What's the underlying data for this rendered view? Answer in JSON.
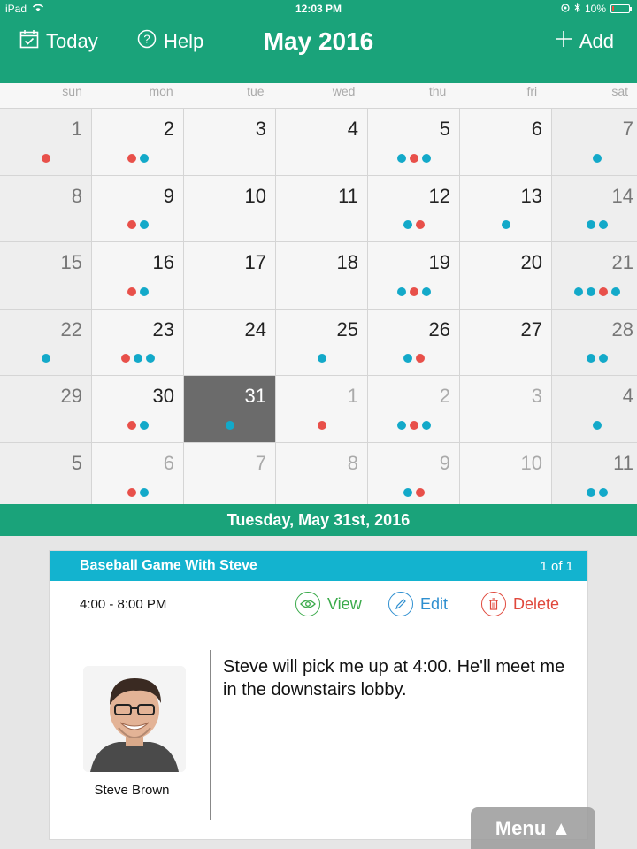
{
  "status_bar": {
    "device": "iPad",
    "time": "12:03 PM",
    "battery": "10%",
    "battery_level": 0.1
  },
  "nav": {
    "today": "Today",
    "help": "Help",
    "title": "May 2016",
    "add": "Add"
  },
  "weekdays": [
    "sun",
    "mon",
    "tue",
    "wed",
    "thu",
    "fri",
    "sat"
  ],
  "colors": {
    "primary": "#1aa37a",
    "accent_blue": "#13b3cf",
    "dot_red": "#e8504a",
    "dot_blue": "#13a9c9",
    "view": "#3aaa4a",
    "edit": "#2e8fd0",
    "delete": "#e0483c"
  },
  "calendar": {
    "days": [
      {
        "n": "1",
        "dots": [
          "r"
        ],
        "other": false
      },
      {
        "n": "2",
        "dots": [
          "r",
          "b"
        ],
        "other": false
      },
      {
        "n": "3",
        "dots": [],
        "other": false
      },
      {
        "n": "4",
        "dots": [],
        "other": false
      },
      {
        "n": "5",
        "dots": [
          "b",
          "r",
          "b"
        ],
        "other": false
      },
      {
        "n": "6",
        "dots": [],
        "other": false
      },
      {
        "n": "7",
        "dots": [
          "b"
        ],
        "other": false
      },
      {
        "n": "8",
        "dots": [],
        "other": false
      },
      {
        "n": "9",
        "dots": [
          "r",
          "b"
        ],
        "other": false
      },
      {
        "n": "10",
        "dots": [],
        "other": false
      },
      {
        "n": "11",
        "dots": [],
        "other": false
      },
      {
        "n": "12",
        "dots": [
          "b",
          "r"
        ],
        "other": false
      },
      {
        "n": "13",
        "dots": [
          "b"
        ],
        "other": false
      },
      {
        "n": "14",
        "dots": [
          "b",
          "b"
        ],
        "other": false
      },
      {
        "n": "15",
        "dots": [],
        "other": false
      },
      {
        "n": "16",
        "dots": [
          "r",
          "b"
        ],
        "other": false
      },
      {
        "n": "17",
        "dots": [],
        "other": false
      },
      {
        "n": "18",
        "dots": [],
        "other": false
      },
      {
        "n": "19",
        "dots": [
          "b",
          "r",
          "b"
        ],
        "other": false
      },
      {
        "n": "20",
        "dots": [],
        "other": false
      },
      {
        "n": "21",
        "dots": [
          "b",
          "b",
          "r",
          "b"
        ],
        "other": false
      },
      {
        "n": "22",
        "dots": [
          "b"
        ],
        "other": false
      },
      {
        "n": "23",
        "dots": [
          "r",
          "b",
          "b"
        ],
        "other": false
      },
      {
        "n": "24",
        "dots": [],
        "other": false
      },
      {
        "n": "25",
        "dots": [
          "b"
        ],
        "other": false
      },
      {
        "n": "26",
        "dots": [
          "b",
          "r"
        ],
        "other": false
      },
      {
        "n": "27",
        "dots": [],
        "other": false
      },
      {
        "n": "28",
        "dots": [
          "b",
          "b"
        ],
        "other": false
      },
      {
        "n": "29",
        "dots": [],
        "other": false
      },
      {
        "n": "30",
        "dots": [
          "r",
          "b"
        ],
        "other": false
      },
      {
        "n": "31",
        "dots": [
          "b"
        ],
        "other": false,
        "selected": true
      },
      {
        "n": "1",
        "dots": [
          "r"
        ],
        "other": true
      },
      {
        "n": "2",
        "dots": [
          "b",
          "r",
          "b"
        ],
        "other": true
      },
      {
        "n": "3",
        "dots": [],
        "other": true
      },
      {
        "n": "4",
        "dots": [
          "b"
        ],
        "other": true
      },
      {
        "n": "5",
        "dots": [],
        "other": true
      },
      {
        "n": "6",
        "dots": [
          "r",
          "b"
        ],
        "other": true
      },
      {
        "n": "7",
        "dots": [],
        "other": true
      },
      {
        "n": "8",
        "dots": [],
        "other": true
      },
      {
        "n": "9",
        "dots": [
          "b",
          "r"
        ],
        "other": true
      },
      {
        "n": "10",
        "dots": [],
        "other": true
      },
      {
        "n": "11",
        "dots": [
          "b",
          "b"
        ],
        "other": true
      }
    ]
  },
  "selected_date": "Tuesday, May 31st, 2016",
  "event": {
    "title": "Baseball Game With Steve",
    "count": "1 of 1",
    "time": "4:00 - 8:00 PM",
    "view": "View",
    "edit": "Edit",
    "delete": "Delete",
    "person": "Steve Brown",
    "note": "Steve will pick me up at 4:00.  He'll meet me in the downstairs lobby."
  },
  "menu": {
    "label": "Menu ▲"
  }
}
